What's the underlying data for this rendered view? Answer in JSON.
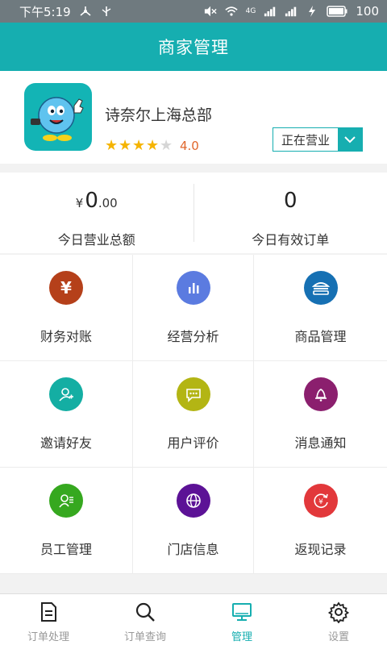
{
  "status_bar": {
    "time": "下午5:19",
    "network_label": "4G",
    "battery": "100"
  },
  "header": {
    "title": "商家管理"
  },
  "store": {
    "name": "诗奈尔上海总部",
    "rating_value": "4.0",
    "stars_filled": 4,
    "stars_total": 5,
    "status_label": "正在营业"
  },
  "stats": {
    "revenue": {
      "currency": "¥",
      "integer": "0",
      "decimal": ".00",
      "label": "今日营业总额"
    },
    "orders": {
      "value": "0",
      "label": "今日有效订单"
    }
  },
  "grid": [
    {
      "label": "财务对账",
      "icon": "yen-icon",
      "color": "#b5401a"
    },
    {
      "label": "经营分析",
      "icon": "bar-chart-icon",
      "color": "#5b7be0"
    },
    {
      "label": "商品管理",
      "icon": "burger-icon",
      "color": "#1670b3"
    },
    {
      "label": "邀请好友",
      "icon": "add-user-icon",
      "color": "#14aea3"
    },
    {
      "label": "用户评价",
      "icon": "chat-icon",
      "color": "#b3b514"
    },
    {
      "label": "消息通知",
      "icon": "bell-icon",
      "color": "#8b1f6e"
    },
    {
      "label": "员工管理",
      "icon": "staff-icon",
      "color": "#36a81f"
    },
    {
      "label": "门店信息",
      "icon": "globe-icon",
      "color": "#5c1296"
    },
    {
      "label": "返现记录",
      "icon": "cashback-icon",
      "color": "#e2383b"
    }
  ],
  "tabs": [
    {
      "label": "订单处理",
      "icon": "document-icon"
    },
    {
      "label": "订单查询",
      "icon": "search-icon"
    },
    {
      "label": "管理",
      "icon": "monitor-icon",
      "active": true
    },
    {
      "label": "设置",
      "icon": "gear-icon"
    }
  ],
  "colors": {
    "primary": "#16aeb0",
    "star": "#f5b400",
    "rating": "#e0672c"
  }
}
